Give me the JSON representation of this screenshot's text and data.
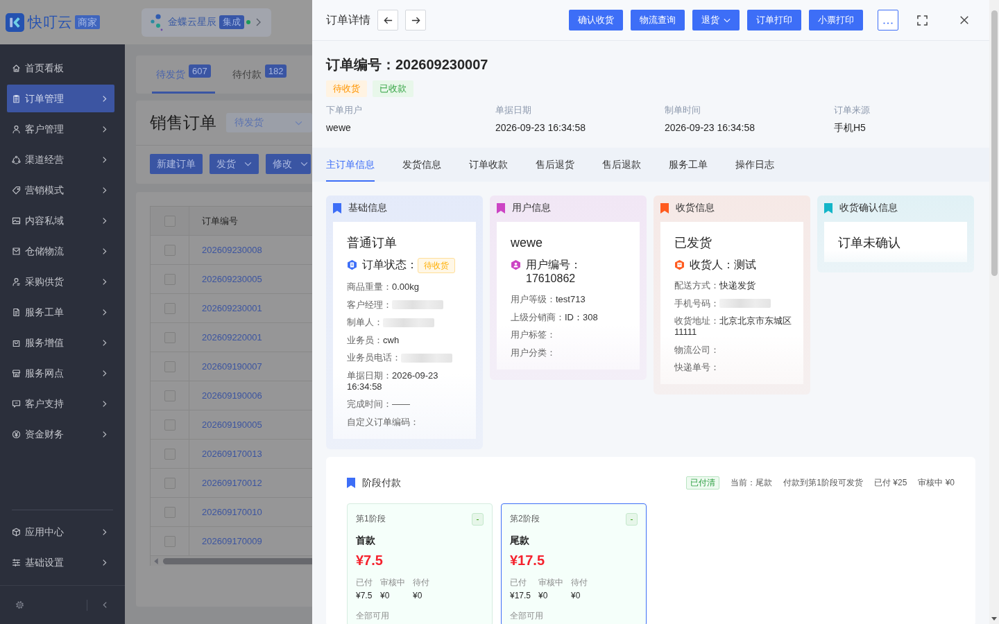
{
  "app": {
    "logo": {
      "name": "快叮云",
      "badge": "商家"
    },
    "integration": {
      "name": "金蝶云星辰",
      "badge": "集成",
      "connected": true
    },
    "nav": [
      {
        "label": "首页看板",
        "submenu": false,
        "selected": false
      },
      {
        "label": "订单管理",
        "submenu": true,
        "selected": true
      },
      {
        "label": "客户管理",
        "submenu": true,
        "selected": false
      },
      {
        "label": "渠道经营",
        "submenu": true,
        "selected": false
      },
      {
        "label": "营销模式",
        "submenu": true,
        "selected": false
      },
      {
        "label": "内容私域",
        "submenu": true,
        "selected": false
      },
      {
        "label": "仓储物流",
        "submenu": true,
        "selected": false
      },
      {
        "label": "采购供货",
        "submenu": true,
        "selected": false
      },
      {
        "label": "服务工单",
        "submenu": true,
        "selected": false
      },
      {
        "label": "服务增值",
        "submenu": true,
        "selected": false
      },
      {
        "label": "服务网点",
        "submenu": true,
        "selected": false
      },
      {
        "label": "客户支持",
        "submenu": true,
        "selected": false
      },
      {
        "label": "资金财务",
        "submenu": true,
        "selected": false
      }
    ],
    "nav_bottom": [
      {
        "label": "应用中心",
        "submenu": true,
        "selected": false
      },
      {
        "label": "基础设置",
        "submenu": true,
        "selected": false
      }
    ],
    "status_tabs": [
      {
        "label": "待发货",
        "count": "607",
        "selected": true
      },
      {
        "label": "待付款",
        "count": "182",
        "selected": false
      }
    ],
    "page_title": "销售订单",
    "status_filter": {
      "value": "待发货"
    },
    "actions": [
      {
        "label": "新建订单",
        "dropdown": false
      },
      {
        "label": "发货",
        "dropdown": true
      },
      {
        "label": "修改",
        "dropdown": true
      }
    ],
    "table": {
      "select_all": false,
      "columns": [
        "订单编号"
      ],
      "rows": [
        {
          "checked": false,
          "order_no": "202609230008"
        },
        {
          "checked": false,
          "order_no": "202609230005"
        },
        {
          "checked": false,
          "order_no": "202609230001"
        },
        {
          "checked": false,
          "order_no": "202609220001"
        },
        {
          "checked": false,
          "order_no": "202609190007"
        },
        {
          "checked": false,
          "order_no": "202609190006"
        },
        {
          "checked": false,
          "order_no": "202609190005"
        },
        {
          "checked": false,
          "order_no": "202609170013"
        },
        {
          "checked": false,
          "order_no": "202609170012"
        },
        {
          "checked": false,
          "order_no": "202609170010"
        },
        {
          "checked": false,
          "order_no": "202609170009"
        }
      ]
    }
  },
  "drawer": {
    "title": "订单详情",
    "actions": [
      {
        "label": "确认收货",
        "dropdown": false
      },
      {
        "label": "物流查询",
        "dropdown": false
      },
      {
        "label": "退货",
        "dropdown": true
      },
      {
        "label": "订单打印",
        "dropdown": false
      },
      {
        "label": "小票打印",
        "dropdown": false
      }
    ],
    "order_heading": "订单编号：202609230007",
    "tags": [
      {
        "label": "待收货",
        "color": "#fff3e2"
      },
      {
        "label": "已收款",
        "color": "#e8f7ea"
      }
    ],
    "meta": [
      {
        "label": "下单用户",
        "value": "wewe"
      },
      {
        "label": "单据日期",
        "value": "2026-09-23 16:34:58"
      },
      {
        "label": "制单时间",
        "value": "2026-09-23 16:34:58"
      },
      {
        "label": "订单来源",
        "value": "手机H5"
      }
    ],
    "tabs": [
      {
        "label": "主订单信息",
        "selected": true
      },
      {
        "label": "发货信息",
        "selected": false
      },
      {
        "label": "订单收款",
        "selected": false
      },
      {
        "label": "售后退货",
        "selected": false
      },
      {
        "label": "售后退款",
        "selected": false
      },
      {
        "label": "服务工单",
        "selected": false
      },
      {
        "label": "操作日志",
        "selected": false
      }
    ],
    "cards": [
      {
        "title": "基础信息",
        "color": "#3d6ef7",
        "heading": "普通订单",
        "subtitle": {
          "text": "订单状态：",
          "tag": {
            "label": "待收货",
            "color": "#fff7e6"
          }
        },
        "rows": [
          {
            "kind": "text",
            "label": "商品重量：",
            "value": "0.00kg"
          },
          {
            "kind": "blurred",
            "label": "客户经理："
          },
          {
            "kind": "blurred",
            "label": "制单人："
          },
          {
            "kind": "text",
            "label": "业务员：",
            "value": "cwh"
          },
          {
            "kind": "blurred",
            "label": "业务员电话："
          },
          {
            "kind": "text",
            "label": "单据日期：",
            "value": "2026-09-23 16:34:58"
          },
          {
            "kind": "empty",
            "label": "完成时间：",
            "dash": "——"
          },
          {
            "kind": "text",
            "label": "自定义订单编码："
          }
        ]
      },
      {
        "title": "用户信息",
        "color": "#cc44c4",
        "heading": "wewe",
        "subtitle": {
          "text": "用户编号：17610862"
        },
        "rows": [
          {
            "kind": "text",
            "label": "用户等级：",
            "value": "test713"
          },
          {
            "kind": "text",
            "label": "上级分销商：",
            "value": "ID：308"
          },
          {
            "kind": "text",
            "label": "用户标签："
          },
          {
            "kind": "text",
            "label": "用户分类："
          }
        ]
      },
      {
        "title": "收货信息",
        "color": "#ff5b1f",
        "heading": "已发货",
        "subtitle": {
          "text": "收货人：测试"
        },
        "rows": [
          {
            "kind": "text",
            "label": "配送方式：",
            "value": "快递发货"
          },
          {
            "kind": "blurred",
            "label": "手机号码："
          },
          {
            "kind": "text",
            "label": "收货地址：",
            "value": "北京北京市东城区11111"
          },
          {
            "kind": "text",
            "label": "物流公司："
          },
          {
            "kind": "text",
            "label": "快递单号："
          }
        ]
      },
      {
        "title": "收货确认信息",
        "color": "#13b5c8",
        "heading": "订单未确认"
      }
    ],
    "stage_payment": {
      "title": "阶段付款",
      "status": "已付清",
      "summary": [
        "当前：尾款",
        "付款到第1阶段可发货",
        "已付 ¥25",
        "审核中 ¥0"
      ],
      "stages": [
        {
          "step": "第1阶段",
          "badge": "-",
          "name": "首款",
          "amount": "¥7.5",
          "amounts": [
            {
              "label": "已付",
              "value": "¥7.5"
            },
            {
              "label": "审核中",
              "value": "¥0"
            },
            {
              "label": "待付",
              "value": "¥0"
            }
          ],
          "note": "全部可用",
          "selected": false
        },
        {
          "step": "第2阶段",
          "badge": "-",
          "name": "尾款",
          "amount": "¥17.5",
          "amounts": [
            {
              "label": "已付",
              "value": "¥17.5"
            },
            {
              "label": "审核中",
              "value": "¥0"
            },
            {
              "label": "待付",
              "value": "¥0"
            }
          ],
          "note": "全部可用",
          "selected": true
        }
      ]
    }
  }
}
